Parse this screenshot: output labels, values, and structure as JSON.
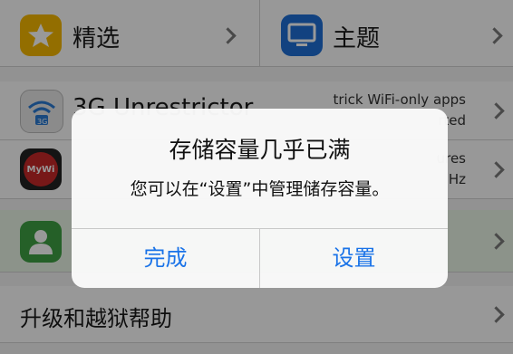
{
  "rows": {
    "top": {
      "left_label": "精选",
      "right_label": "主题"
    },
    "row2": {
      "title": "3G Unrestrictor",
      "subtitle_1": "trick WiFi-only apps",
      "subtitle_2": "rted",
      "app_icon_text": "3G"
    },
    "row3": {
      "subtitle_1": "ures",
      "subtitle_2": "Hz",
      "app_icon_text": "MyWi"
    },
    "bottom": {
      "label": "升级和越狱帮助"
    }
  },
  "alert": {
    "title": "存储容量几乎已满",
    "message": "您可以在“设置”中管理储存容量。",
    "buttons": {
      "done": "完成",
      "settings": "设置"
    }
  },
  "colors": {
    "accent": "#1a73e8",
    "star_icon_bg": "#f5b800",
    "monitor_icon_bg": "#1e6fd6",
    "contact_icon_bg": "#3ea043"
  }
}
